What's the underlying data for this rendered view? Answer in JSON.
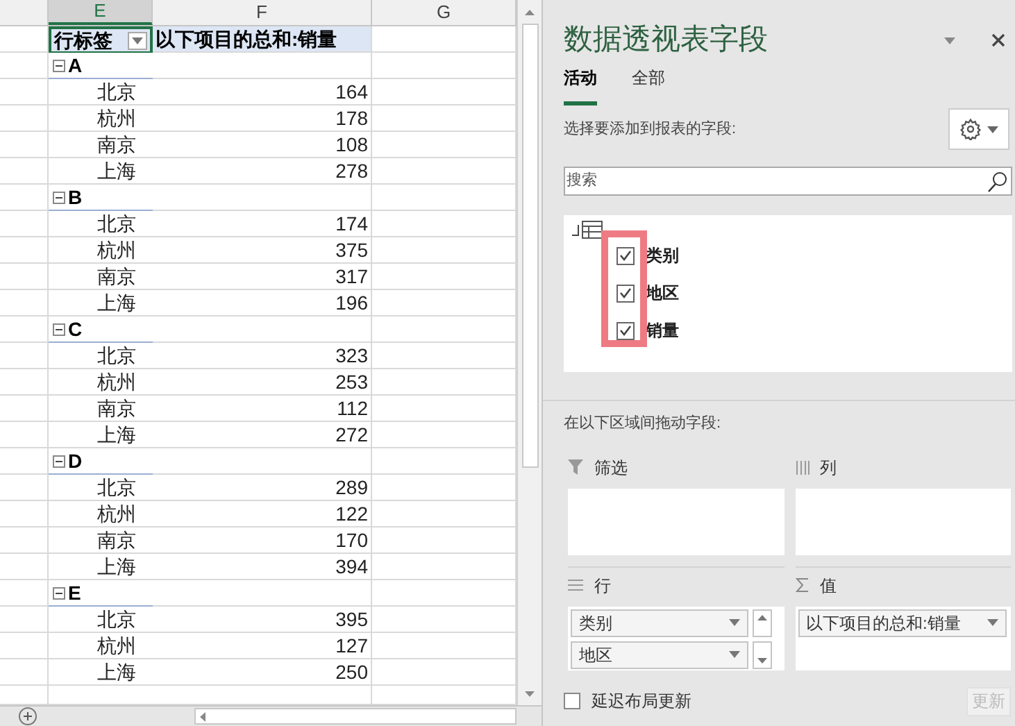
{
  "sheet": {
    "columns": [
      {
        "label": "E",
        "selected": true
      },
      {
        "label": "F",
        "selected": false
      },
      {
        "label": "G",
        "selected": false
      }
    ],
    "pivot": {
      "row_label": "行标签",
      "value_label": "以下项目的总和:销量",
      "groups": [
        {
          "name": "A",
          "expanded": true,
          "items": [
            {
              "city": "北京",
              "value": "164"
            },
            {
              "city": "杭州",
              "value": "178"
            },
            {
              "city": "南京",
              "value": "108"
            },
            {
              "city": "上海",
              "value": "278"
            }
          ]
        },
        {
          "name": "B",
          "expanded": true,
          "items": [
            {
              "city": "北京",
              "value": "174"
            },
            {
              "city": "杭州",
              "value": "375"
            },
            {
              "city": "南京",
              "value": "317"
            },
            {
              "city": "上海",
              "value": "196"
            }
          ]
        },
        {
          "name": "C",
          "expanded": true,
          "items": [
            {
              "city": "北京",
              "value": "323"
            },
            {
              "city": "杭州",
              "value": "253"
            },
            {
              "city": "南京",
              "value": "112"
            },
            {
              "city": "上海",
              "value": "272"
            }
          ]
        },
        {
          "name": "D",
          "expanded": true,
          "items": [
            {
              "city": "北京",
              "value": "289"
            },
            {
              "city": "杭州",
              "value": "122"
            },
            {
              "city": "南京",
              "value": "170"
            },
            {
              "city": "上海",
              "value": "394"
            }
          ]
        },
        {
          "name": "E",
          "expanded": true,
          "items": [
            {
              "city": "北京",
              "value": "395"
            },
            {
              "city": "杭州",
              "value": "127"
            },
            {
              "city": "上海",
              "value": "250"
            }
          ]
        }
      ]
    }
  },
  "panel": {
    "title": "数据透视表字段",
    "tabs": [
      {
        "label": "活动",
        "selected": true
      },
      {
        "label": "全部",
        "selected": false
      }
    ],
    "prompt": "选择要添加到报表的字段:",
    "search": {
      "placeholder": "搜索"
    },
    "fields": [
      {
        "label": "类别",
        "checked": true
      },
      {
        "label": "地区",
        "checked": true
      },
      {
        "label": "销量",
        "checked": true
      }
    ],
    "drag_prompt": "在以下区域间拖动字段:",
    "filters": {
      "label": "筛选"
    },
    "columns": {
      "label": "列"
    },
    "rows": {
      "label": "行",
      "items": [
        "类别",
        "地区"
      ]
    },
    "values": {
      "label": "值",
      "items": [
        "以下项目的总和:销量"
      ]
    },
    "defer": {
      "label": "延迟布局更新",
      "checked": false
    },
    "update_button": {
      "label": "更新",
      "disabled": true
    }
  }
}
